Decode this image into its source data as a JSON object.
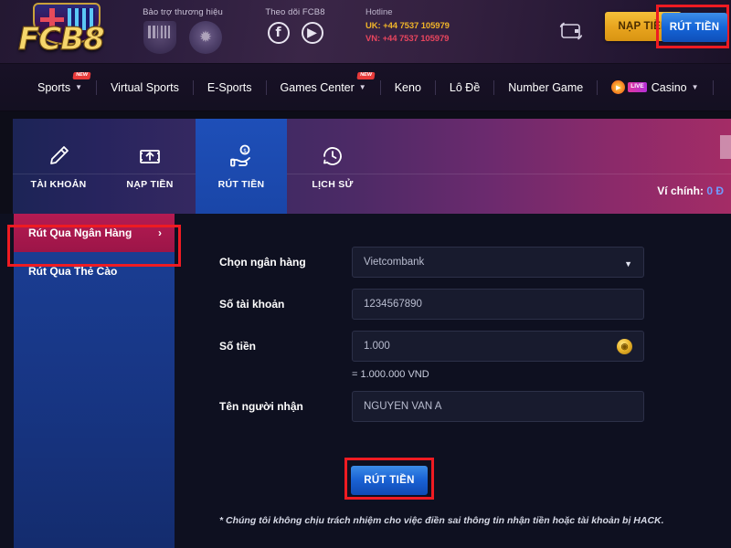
{
  "header": {
    "logo_text": "FCB8",
    "logo_icon": "fcb8-crest-logo",
    "sponsor": {
      "label": "Bảo trợ thương hiệu",
      "logos": [
        {
          "name": "fc-barcelona-crest-icon"
        },
        {
          "name": "isle-of-man-crest-icon"
        }
      ]
    },
    "follow": {
      "label": "Theo dõi FCB8",
      "socials": [
        {
          "name": "facebook-icon",
          "glyph": "f"
        },
        {
          "name": "youtube-icon",
          "glyph": "▶"
        }
      ]
    },
    "hotline": {
      "label": "Hotline",
      "uk": "UK: +44 7537 105979",
      "vn": "VN: +44 7537 105979"
    },
    "wallet_icon": "wallet-refresh-icon",
    "deposit_label": "NẠP TIỀN",
    "withdraw_label": "RÚT TIỀN"
  },
  "nav": {
    "items": [
      {
        "label": "Sports",
        "caret": "▼",
        "badge": "NEW"
      },
      {
        "label": "Virtual Sports",
        "caret": "",
        "badge": ""
      },
      {
        "label": "E-Sports",
        "caret": "",
        "badge": ""
      },
      {
        "label": "Games Center",
        "caret": "▼",
        "badge": "NEW"
      },
      {
        "label": "Keno",
        "caret": "",
        "badge": ""
      },
      {
        "label": "Lô Đề",
        "caret": "",
        "badge": ""
      },
      {
        "label": "Number Game",
        "caret": "",
        "badge": ""
      },
      {
        "label": "Casino",
        "caret": "▼",
        "badge": "",
        "live_tag": "LIVE"
      }
    ]
  },
  "tabs": {
    "items": [
      {
        "label": "TÀI KHOẢN",
        "icon": "pencil-edit-icon",
        "active": false
      },
      {
        "label": "NẠP TIỀN",
        "icon": "deposit-money-upload-icon",
        "active": false
      },
      {
        "label": "RÚT TIỀN",
        "icon": "withdraw-hand-money-icon",
        "active": true
      },
      {
        "label": "LỊCH SỬ",
        "icon": "history-clock-icon",
        "active": false
      }
    ],
    "wallet_label": "Ví chính:",
    "wallet_amount": "0 Đ"
  },
  "sidebar": {
    "items": [
      {
        "label": "Rút Qua Ngân Hàng",
        "active": true,
        "chevron": "›"
      },
      {
        "label": "Rút Qua Thẻ Cào",
        "active": false,
        "chevron": ""
      }
    ]
  },
  "form": {
    "bank": {
      "label": "Chọn ngân hàng",
      "value": "Vietcombank",
      "caret_icon": "chevron-down-icon"
    },
    "account_number": {
      "label": "Số tài khoản",
      "value": "1234567890"
    },
    "amount": {
      "label": "Số tiền",
      "value": "1.000",
      "coin_icon": "gold-coin-icon"
    },
    "conversion": "= 1.000.000 VND",
    "recipient": {
      "label": "Tên người nhận",
      "value": "NGUYEN VAN A"
    },
    "submit_label": "RÚT TIỀN",
    "footnote": "* Chúng tôi không chịu trách nhiệm cho việc điền sai thông tin nhận tiền hoặc tài khoản bị HACK."
  },
  "colors": {
    "accent_red": "#ef1b22",
    "accent_blue": "#1a62d4",
    "accent_gold": "#e8a51f",
    "sidebar_blue": "#173583",
    "sidebar_active": "#b51b52"
  }
}
